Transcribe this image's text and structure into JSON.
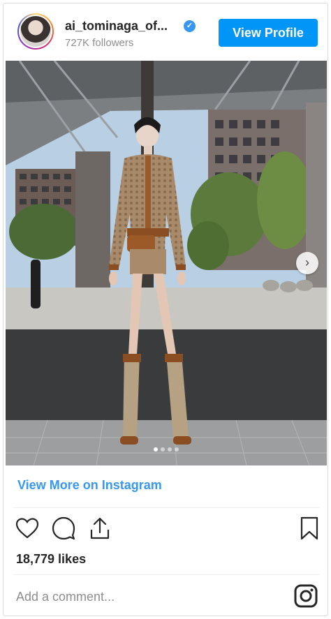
{
  "header": {
    "username": "ai_tominaga_of...",
    "followers": "727K followers",
    "view_profile_label": "View Profile",
    "verified_icon": "verified-badge-icon",
    "verified_color": "#3897f0"
  },
  "post": {
    "carousel_total": 4,
    "carousel_active": 1,
    "next_icon": "chevron-right-icon"
  },
  "footer": {
    "view_more_label": "View More on Instagram",
    "likes": "18,779 likes",
    "comment_placeholder": "Add a comment...",
    "icons": [
      "heart-icon",
      "comment-icon",
      "share-icon",
      "bookmark-icon",
      "instagram-icon"
    ]
  },
  "colors": {
    "accent": "#0095f6",
    "link": "#3897f0",
    "muted": "#8e8e8e",
    "text": "#262626"
  }
}
